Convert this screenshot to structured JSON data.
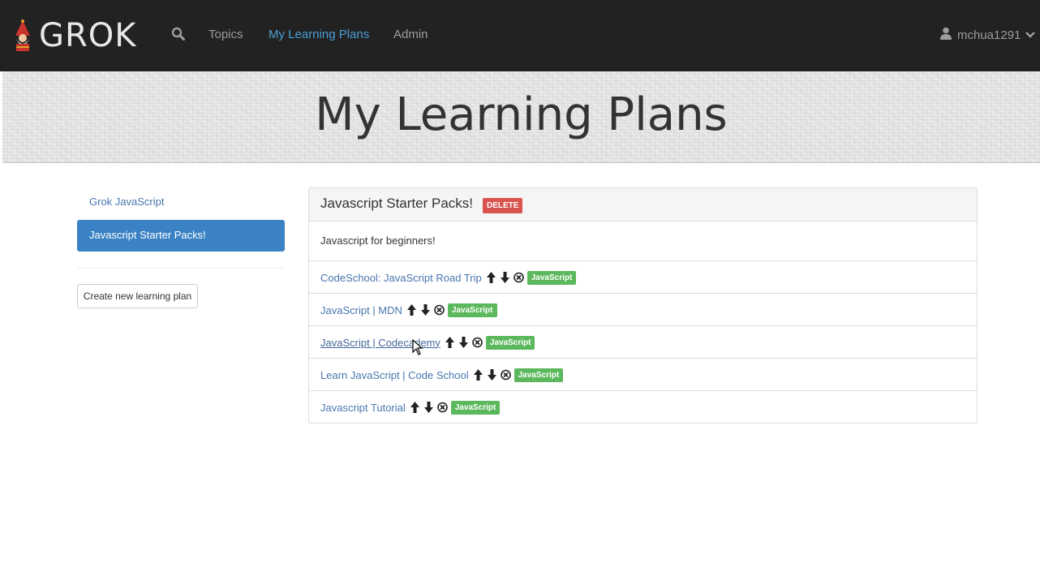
{
  "nav": {
    "brand": "GROK",
    "links": [
      "Topics",
      "My Learning Plans",
      "Admin"
    ],
    "active": "My Learning Plans",
    "user": "mchua1291"
  },
  "hero": {
    "title": "My Learning Plans"
  },
  "sidebar": {
    "items": [
      {
        "label": "Grok JavaScript"
      },
      {
        "label": "Javascript Starter Packs!"
      }
    ],
    "create_label": "Create new learning plan"
  },
  "plan": {
    "title": "Javascript Starter Packs!",
    "delete_label": "DELETE",
    "description": "Javascript for beginners!",
    "resources": [
      {
        "name": "CodeSchool: JavaScript Road Trip",
        "tag": "JavaScript"
      },
      {
        "name": "JavaScript | MDN",
        "tag": "JavaScript"
      },
      {
        "name": "JavaScript | Codecademy",
        "tag": "JavaScript"
      },
      {
        "name": "Learn JavaScript | Code School",
        "tag": "JavaScript"
      },
      {
        "name": "Javascript Tutorial",
        "tag": "JavaScript"
      }
    ]
  },
  "colors": {
    "navbar": "#222222",
    "link": "#4a76b0",
    "active_nav": "#4b9fd5",
    "active_sidebar": "#3a82c4",
    "delete": "#d9534f",
    "tag": "#5cb85c"
  },
  "icons": {
    "brand": "gnome-logo-icon",
    "search": "search-icon",
    "user": "user-icon",
    "caret": "chevron-down-icon",
    "move_up": "arrow-up-icon",
    "move_down": "arrow-down-icon",
    "remove": "remove-circle-icon"
  }
}
